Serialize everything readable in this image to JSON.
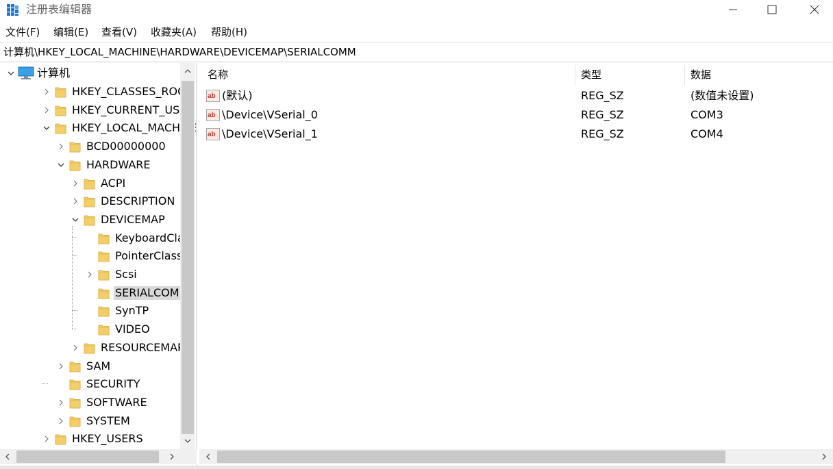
{
  "window": {
    "title": "注册表编辑器",
    "buttons": {
      "minimize": "minimize",
      "maximize": "maximize",
      "close": "close"
    }
  },
  "menu": [
    {
      "label": "文件(F)"
    },
    {
      "label": "编辑(E)"
    },
    {
      "label": "查看(V)"
    },
    {
      "label": "收藏夹(A)"
    },
    {
      "label": "帮助(H)"
    }
  ],
  "address": "计算机\\HKEY_LOCAL_MACHINE\\HARDWARE\\DEVICEMAP\\SERIALCOMM",
  "tree": {
    "root": "计算机",
    "nodes": [
      {
        "label": "HKEY_CLASSES_ROOT",
        "state": "collapsed"
      },
      {
        "label": "HKEY_CURRENT_USER",
        "state": "collapsed"
      },
      {
        "label": "HKEY_LOCAL_MACHINE",
        "state": "expanded"
      },
      {
        "label": "BCD00000000",
        "state": "collapsed"
      },
      {
        "label": "HARDWARE",
        "state": "expanded"
      },
      {
        "label": "ACPI",
        "state": "collapsed"
      },
      {
        "label": "DESCRIPTION",
        "state": "collapsed"
      },
      {
        "label": "DEVICEMAP",
        "state": "expanded"
      },
      {
        "label": "KeyboardClass",
        "state": "leaf"
      },
      {
        "label": "PointerClass",
        "state": "leaf"
      },
      {
        "label": "Scsi",
        "state": "collapsed"
      },
      {
        "label": "SERIALCOMM",
        "state": "leaf",
        "selected": true
      },
      {
        "label": "SynTP",
        "state": "leaf"
      },
      {
        "label": "VIDEO",
        "state": "leaf"
      },
      {
        "label": "RESOURCEMAP",
        "state": "collapsed"
      },
      {
        "label": "SAM",
        "state": "collapsed"
      },
      {
        "label": "SECURITY",
        "state": "leaf"
      },
      {
        "label": "SOFTWARE",
        "state": "collapsed"
      },
      {
        "label": "SYSTEM",
        "state": "collapsed"
      },
      {
        "label": "HKEY_USERS",
        "state": "collapsed"
      }
    ]
  },
  "values": {
    "columns": {
      "name": "名称",
      "type": "类型",
      "data": "数据"
    },
    "rows": [
      {
        "name": "(默认)",
        "type": "REG_SZ",
        "data": "(数值未设置)"
      },
      {
        "name": "\\Device\\VSerial_0",
        "type": "REG_SZ",
        "data": "COM3"
      },
      {
        "name": "\\Device\\VSerial_1",
        "type": "REG_SZ",
        "data": "COM4"
      }
    ]
  },
  "colors": {
    "folder": "#f3cf6a",
    "folder_edge": "#d9a63a",
    "selection": "#d9d9d9",
    "scrollbar_track": "#f0f0f0",
    "scrollbar_thumb": "#c8c8c8",
    "app_icon": "#1e78d2"
  }
}
